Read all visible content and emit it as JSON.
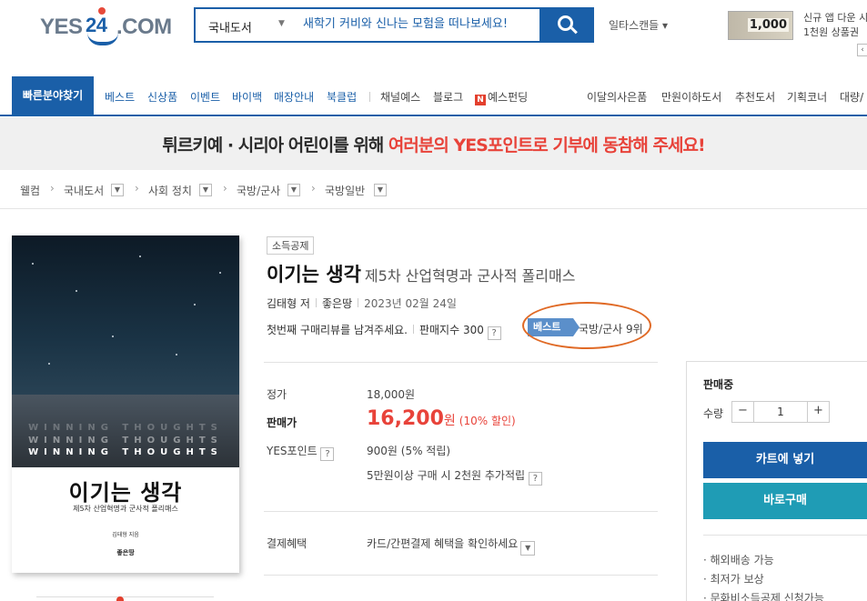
{
  "header": {
    "logo_text": {
      "yes": "YES",
      "num": "24",
      "com": ".COM"
    },
    "search": {
      "category": "국내도서",
      "placeholder": "새학기 커비와 신나는 모험을 떠나보세요!"
    },
    "ilta_label": "일타스캔들 ▾",
    "promo": {
      "amount": "1,000",
      "line1": "신규 앱 다운 시",
      "line2": "1천원 상품권"
    }
  },
  "nav": {
    "main_label": "빠른분야찾기",
    "left_items": [
      "베스트",
      "신상품",
      "이벤트",
      "바이백",
      "매장안내",
      "북클럽"
    ],
    "mid_items": [
      "채널예스",
      "블로그",
      "예스펀딩"
    ],
    "n_badge": "N",
    "right_items": [
      "이달의사은품",
      "만원이하도서",
      "추천도서",
      "기획코너",
      "대량/"
    ]
  },
  "banner": {
    "part1": "튀르키예 · 시리아 어린이를 위해 ",
    "part2": "여러분의 YES포인트로 기부에 동참해 주세요!"
  },
  "breadcrumb": [
    "웰컴",
    "국내도서",
    "사회 정치",
    "국방/군사",
    "국방일반"
  ],
  "book": {
    "tag": "소득공제",
    "title": "이기는 생각",
    "subtitle": "제5차 산업혁명과 군사적 폴리매스",
    "author": "김태형 저",
    "publisher": "좋은땅",
    "date": "2023년 02월 24일",
    "review_prompt": "첫번째 구매리뷰를 남겨주세요.",
    "sales_index": "판매지수 300",
    "best_label": "베스트",
    "rank": "국방/군사 9위",
    "cover": {
      "winning_thoughts": "WINNING THOUGHTS",
      "title": "이기는 생각",
      "subtitle": "제5차 산업혁명과 군사적 폴리매스",
      "author": "김태형 지음",
      "publisher": "좋은땅"
    }
  },
  "price": {
    "list_label": "정가",
    "list_value": "18,000원",
    "sale_label": "판매가",
    "sale_value": "16,200",
    "won": "원",
    "discount": "(10% 할인)",
    "points_label": "YES포인트",
    "points_value": "900원 (5% 적립)",
    "points_extra": "5만원이상 구매 시 2천원 추가적립",
    "payment_label": "결제혜택",
    "payment_value": "카드/간편결제 혜택을 확인하세요"
  },
  "panel": {
    "status": "판매중",
    "qty_label": "수량",
    "qty_value": "1",
    "cart_label": "카트에 넣기",
    "buy_label": "바로구매",
    "notes": [
      "· 해외배송 가능",
      "· 최저가 보상",
      "· 문화비소득공제 신청가능"
    ]
  },
  "colors": {
    "brand": "#1a5fa8",
    "accent": "#e8433a",
    "buy": "#1f9cb5",
    "highlight_circle": "#e06a26"
  }
}
